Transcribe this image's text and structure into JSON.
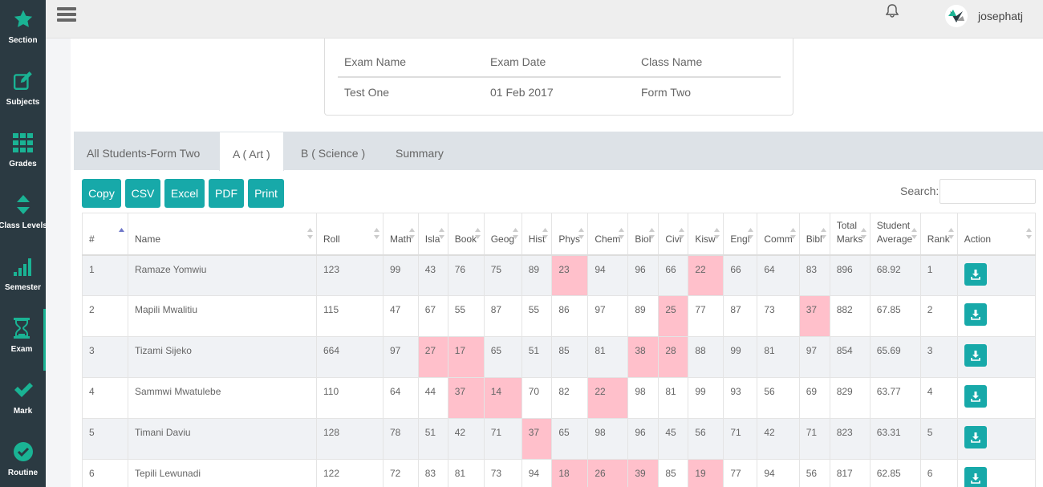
{
  "sidebar": {
    "items": [
      {
        "label": "Section",
        "icon": "star-icon"
      },
      {
        "label": "Subjects",
        "icon": "edit-icon"
      },
      {
        "label": "Grades",
        "icon": "grid-icon"
      },
      {
        "label": "Class Levels",
        "icon": "sort-icon"
      },
      {
        "label": "Semester",
        "icon": "signal-icon"
      },
      {
        "label": "Exam",
        "icon": "hourglass-icon",
        "active": true
      },
      {
        "label": "Mark",
        "icon": "check-icon"
      },
      {
        "label": "Routine",
        "icon": "clock-icon"
      }
    ]
  },
  "topbar": {
    "username": "josephatj"
  },
  "exam_info": {
    "headers": {
      "exam_name": "Exam Name",
      "exam_date": "Exam Date",
      "class_name": "Class Name"
    },
    "values": {
      "exam_name": "Test One",
      "exam_date": "01 Feb 2017",
      "class_name": "Form Two"
    }
  },
  "tabs": [
    {
      "label": "All Students-Form Two"
    },
    {
      "label": "A ( Art )",
      "active": true
    },
    {
      "label": "B ( Science )"
    },
    {
      "label": "Summary"
    }
  ],
  "toolbar": {
    "copy": "Copy",
    "csv": "CSV",
    "excel": "Excel",
    "pdf": "PDF",
    "print": "Print",
    "search_label": "Search:"
  },
  "table": {
    "columns": [
      "#",
      "Name",
      "Roll",
      "Math",
      "Isla",
      "Book",
      "Geog",
      "Hist",
      "Phys",
      "Chem",
      "Biol",
      "Civi",
      "Kisw",
      "Engl",
      "Comm",
      "Bibl",
      "Total Marks",
      "Student Average",
      "Rank",
      "Action"
    ],
    "rows": [
      {
        "num": "1",
        "name": "Ramaze Yomwiu",
        "roll": "123",
        "marks": [
          "99",
          "43",
          "76",
          "75",
          "89",
          "23",
          "94",
          "96",
          "66",
          "22",
          "66",
          "64",
          "83"
        ],
        "low": [
          5,
          9
        ],
        "total": "896",
        "average": "68.92",
        "rank": "1"
      },
      {
        "num": "2",
        "name": "Mapili Mwalitiu",
        "roll": "115",
        "marks": [
          "47",
          "67",
          "55",
          "87",
          "55",
          "86",
          "97",
          "89",
          "25",
          "77",
          "87",
          "73",
          "37"
        ],
        "low": [
          8,
          12
        ],
        "total": "882",
        "average": "67.85",
        "rank": "2"
      },
      {
        "num": "3",
        "name": "Tizami Sijeko",
        "roll": "664",
        "marks": [
          "97",
          "27",
          "17",
          "65",
          "51",
          "85",
          "81",
          "38",
          "28",
          "88",
          "99",
          "81",
          "97"
        ],
        "low": [
          1,
          2,
          7,
          8
        ],
        "total": "854",
        "average": "65.69",
        "rank": "3"
      },
      {
        "num": "4",
        "name": "Sammwi Mwatulebe",
        "roll": "110",
        "marks": [
          "64",
          "44",
          "37",
          "14",
          "70",
          "82",
          "22",
          "98",
          "81",
          "99",
          "93",
          "56",
          "69"
        ],
        "low": [
          2,
          3,
          6
        ],
        "total": "829",
        "average": "63.77",
        "rank": "4"
      },
      {
        "num": "5",
        "name": "Timani Daviu",
        "roll": "128",
        "marks": [
          "78",
          "51",
          "42",
          "71",
          "37",
          "65",
          "98",
          "96",
          "45",
          "56",
          "71",
          "42",
          "71"
        ],
        "low": [
          4
        ],
        "total": "823",
        "average": "63.31",
        "rank": "5"
      },
      {
        "num": "6",
        "name": "Tepili Lewunadi",
        "roll": "122",
        "marks": [
          "72",
          "83",
          "81",
          "73",
          "94",
          "18",
          "26",
          "39",
          "85",
          "19",
          "77",
          "94",
          "56"
        ],
        "low": [
          5,
          6,
          7,
          9
        ],
        "total": "817",
        "average": "62.85",
        "rank": "6"
      }
    ]
  },
  "colors": {
    "sidebar_bg": "#2b3a42",
    "accent": "#17a9a9",
    "low_mark": "#ffc0cb",
    "active_indicator": "#1ab394"
  }
}
